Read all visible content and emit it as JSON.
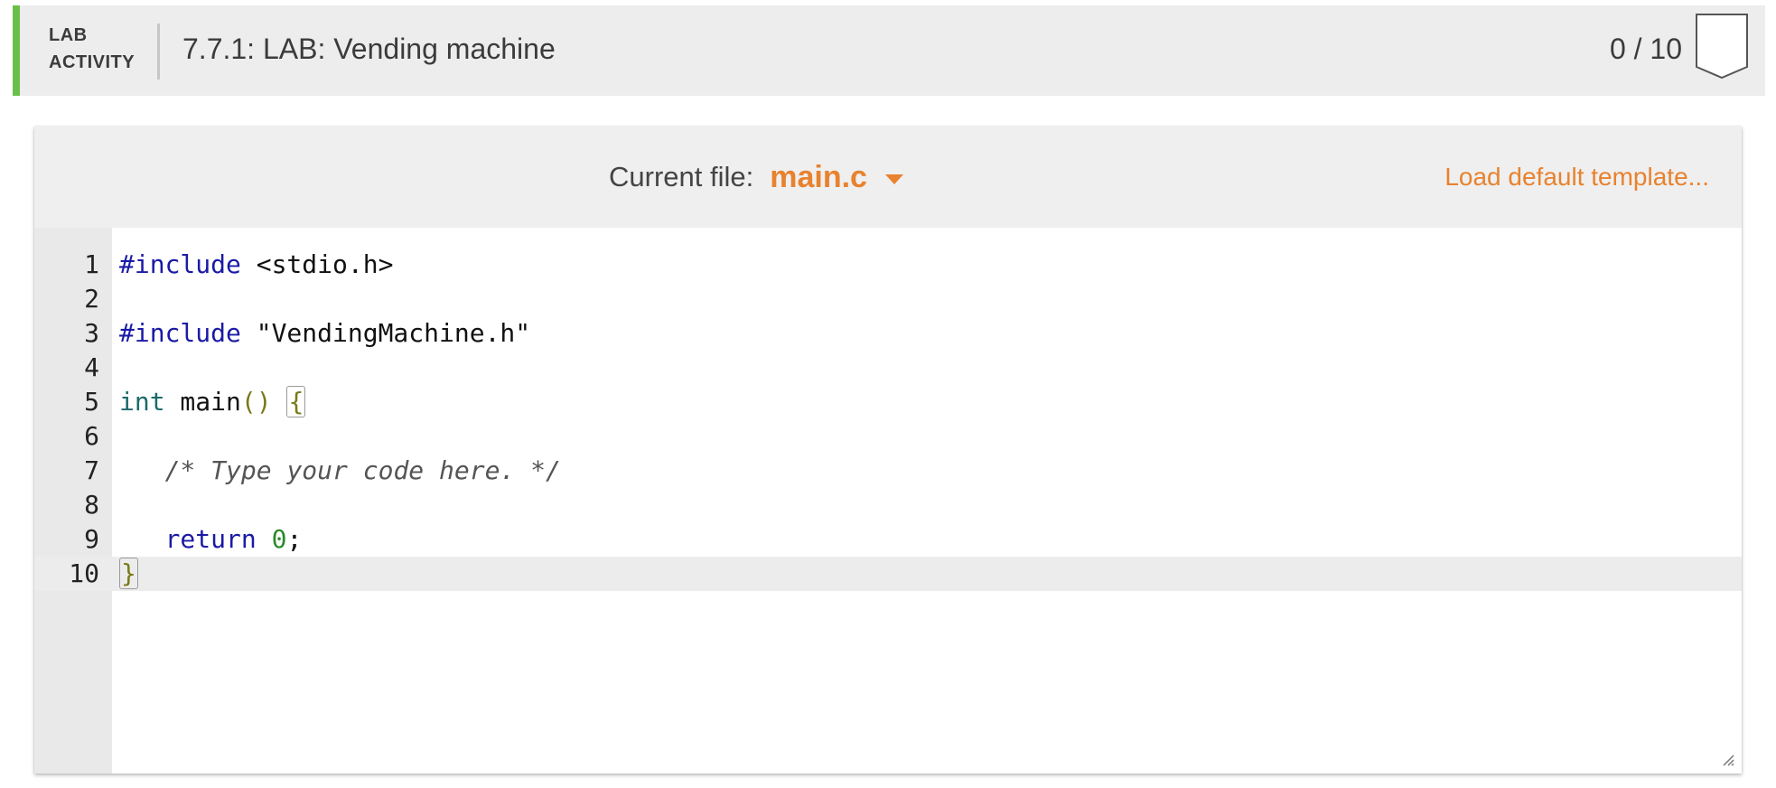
{
  "header": {
    "activity_type_line1": "LAB",
    "activity_type_line2": "ACTIVITY",
    "title": "7.7.1: LAB: Vending machine",
    "score": "0 / 10"
  },
  "toolbar": {
    "current_file_label": "Current file:",
    "current_file_name": "main.c",
    "load_template_label": "Load default template..."
  },
  "editor": {
    "active_line": 10,
    "lines": [
      {
        "number": "1",
        "tokens": [
          {
            "t": "#include",
            "c": "directive"
          },
          {
            "t": " <stdio.h>",
            "c": ""
          }
        ]
      },
      {
        "number": "2",
        "tokens": []
      },
      {
        "number": "3",
        "tokens": [
          {
            "t": "#include",
            "c": "directive"
          },
          {
            "t": " \"VendingMachine.h\"",
            "c": ""
          }
        ]
      },
      {
        "number": "4",
        "tokens": []
      },
      {
        "number": "5",
        "tokens": [
          {
            "t": "int",
            "c": "type"
          },
          {
            "t": " main",
            "c": ""
          },
          {
            "t": "()",
            "c": "paren"
          },
          {
            "t": " ",
            "c": ""
          },
          {
            "t": "{",
            "c": "bracket"
          }
        ]
      },
      {
        "number": "6",
        "tokens": []
      },
      {
        "number": "7",
        "tokens": [
          {
            "t": "   ",
            "c": ""
          },
          {
            "t": "/* Type your code here. */",
            "c": "comment"
          }
        ]
      },
      {
        "number": "8",
        "tokens": []
      },
      {
        "number": "9",
        "tokens": [
          {
            "t": "   ",
            "c": ""
          },
          {
            "t": "return",
            "c": "keyword"
          },
          {
            "t": " ",
            "c": ""
          },
          {
            "t": "0",
            "c": "number"
          },
          {
            "t": ";",
            "c": ""
          }
        ]
      },
      {
        "number": "10",
        "tokens": [
          {
            "t": "}",
            "c": "bracket"
          }
        ]
      }
    ]
  },
  "colors": {
    "accent_orange": "#e8822e",
    "accent_green": "#6abf4b",
    "header_bg": "#ededed"
  },
  "icons": {
    "file_dropdown": "chevron-down-icon",
    "score_badge": "badge-icon",
    "resize": "resize-handle-icon"
  }
}
